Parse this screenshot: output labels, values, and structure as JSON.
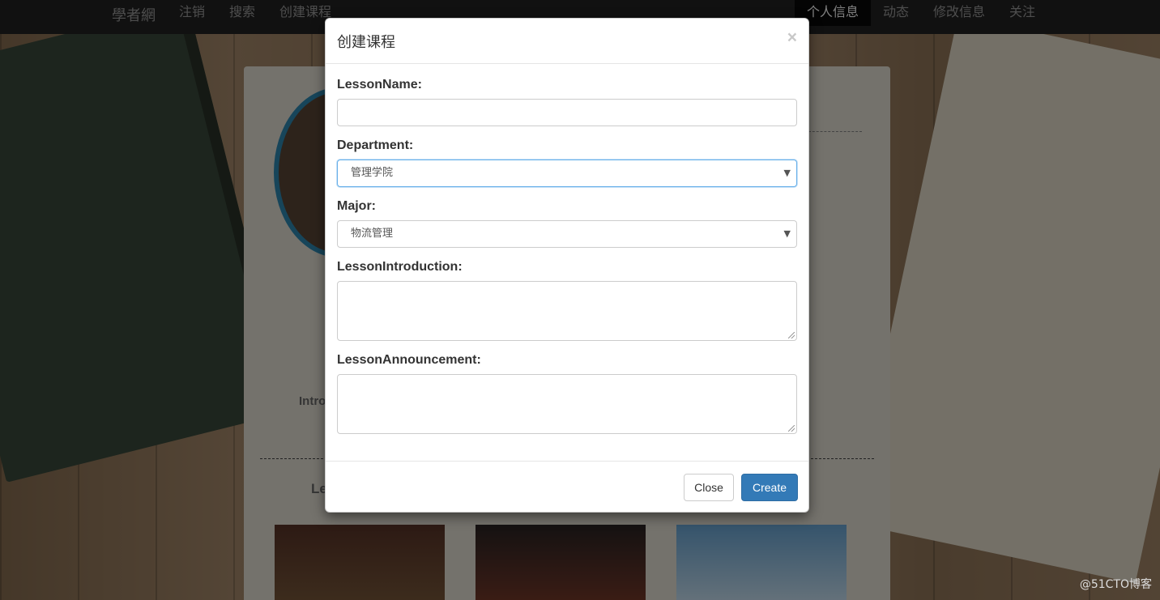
{
  "navbar": {
    "brand": "學者網",
    "left_items": [
      "注销",
      "搜索",
      "创建课程"
    ],
    "right_items": [
      "个人信息",
      "动态",
      "修改信息",
      "关注"
    ],
    "active_right": "个人信息"
  },
  "background": {
    "intro_label": "Intro",
    "section_label": "Le"
  },
  "modal": {
    "title": "创建课程",
    "close_symbol": "×",
    "fields": {
      "lesson_name": {
        "label": "LessonName:",
        "value": ""
      },
      "department": {
        "label": "Department:",
        "selected": "管理学院"
      },
      "major": {
        "label": "Major:",
        "selected": "物流管理"
      },
      "lesson_introduction": {
        "label": "LessonIntroduction:",
        "value": ""
      },
      "lesson_announcement": {
        "label": "LessonAnnouncement:",
        "value": ""
      }
    },
    "buttons": {
      "close": "Close",
      "create": "Create"
    }
  },
  "watermark": "@51CTO博客",
  "colors": {
    "primary": "#337ab7",
    "navbar": "#222222",
    "focus": "#66afe9"
  }
}
